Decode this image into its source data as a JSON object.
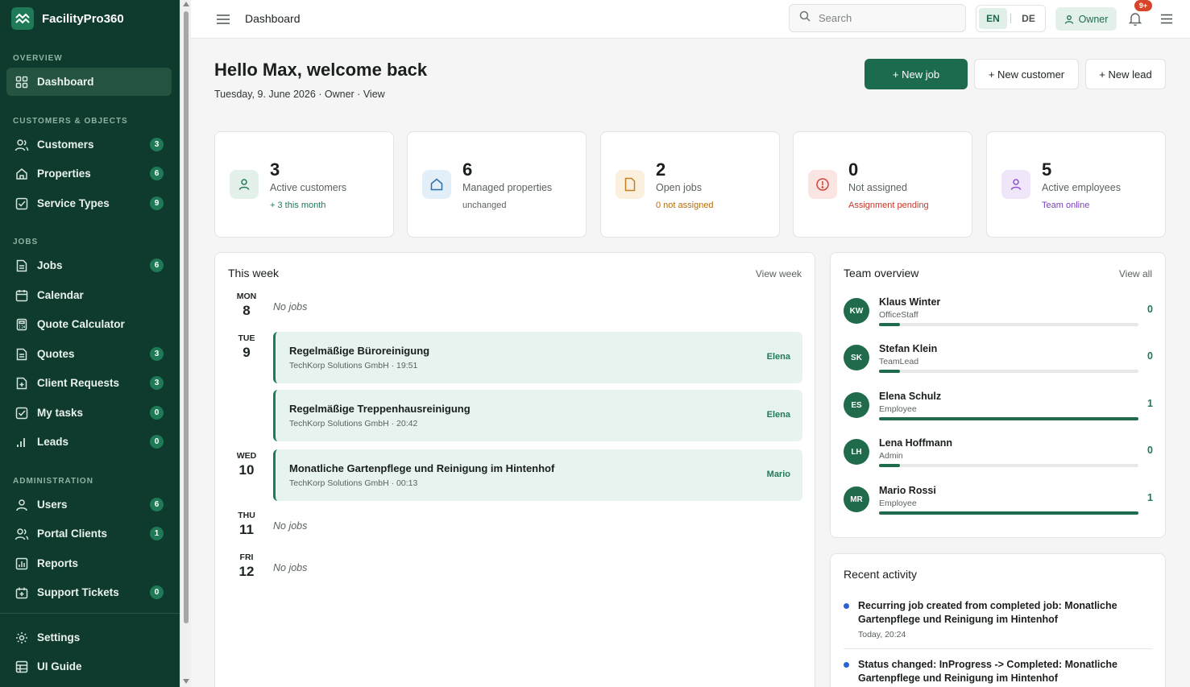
{
  "app": {
    "name": "FacilityPro360"
  },
  "sidebar": {
    "sections": [
      "OVERVIEW",
      "CUSTOMERS & OBJECTS",
      "JOBS",
      "ADMINISTRATION"
    ],
    "items": [
      {
        "label": "Dashboard",
        "icon": "grid-icon"
      },
      {
        "label": "Customers",
        "badge": "3",
        "icon": "users-icon"
      },
      {
        "label": "Properties",
        "badge": "6",
        "icon": "home-icon"
      },
      {
        "label": "Service Types",
        "badge": "9",
        "icon": "checkbox-icon"
      },
      {
        "label": "Jobs",
        "badge": "6",
        "icon": "document-icon"
      },
      {
        "label": "Calendar",
        "icon": "calendar-icon"
      },
      {
        "label": "Quote Calculator",
        "icon": "calculator-icon"
      },
      {
        "label": "Quotes",
        "badge": "3",
        "icon": "document-icon"
      },
      {
        "label": "Client Requests",
        "badge": "3",
        "icon": "file-plus-icon"
      },
      {
        "label": "My tasks",
        "badge": "0",
        "icon": "checkbox-icon"
      },
      {
        "label": "Leads",
        "badge": "0",
        "icon": "bar-chart-icon"
      },
      {
        "label": "Users",
        "badge": "6",
        "icon": "user-icon"
      },
      {
        "label": "Portal Clients",
        "badge": "1",
        "icon": "users-icon"
      },
      {
        "label": "Reports",
        "icon": "report-icon"
      },
      {
        "label": "Support Tickets",
        "badge": "0",
        "icon": "ticket-icon"
      },
      {
        "label": "Settings",
        "icon": "gear-icon"
      },
      {
        "label": "UI Guide",
        "icon": "table-icon"
      }
    ]
  },
  "topbar": {
    "breadcrumb": "Dashboard",
    "search_placeholder": "Search",
    "lang": [
      "EN",
      "DE"
    ],
    "role": "Owner",
    "notifications": "9+"
  },
  "header": {
    "greeting": "Hello Max, welcome back",
    "subline": "Tuesday, 9. June 2026 · Owner · View",
    "buttons": [
      "+ New job",
      "+ New customer",
      "+ New lead"
    ]
  },
  "stats": [
    {
      "value": "3",
      "label": "Active customers",
      "note": "+ 3 this month",
      "note_color": "#1f7a58",
      "icon": "user-icon",
      "icon_bg": "#e3f1ea",
      "icon_color": "#1f7a58"
    },
    {
      "value": "6",
      "label": "Managed properties",
      "note": "unchanged",
      "note_color": "#5a625e",
      "icon": "home-icon",
      "icon_bg": "#e3eff8",
      "icon_color": "#2e6fa8"
    },
    {
      "value": "2",
      "label": "Open jobs",
      "note": "0 not assigned",
      "note_color": "#b06d12",
      "icon": "document-icon",
      "icon_bg": "#fbf0de",
      "icon_color": "#c28021"
    },
    {
      "value": "0",
      "label": "Not assigned",
      "note": "Assignment pending",
      "note_color": "#c43a2b",
      "icon": "alert-circle-icon",
      "icon_bg": "#fbe5e3",
      "icon_color": "#d0423a"
    },
    {
      "value": "5",
      "label": "Active employees",
      "note": "Team online",
      "note_color": "#7a3fc4",
      "icon": "user-icon",
      "icon_bg": "#efe6fa",
      "icon_color": "#8a4fd4"
    }
  ],
  "week": {
    "title": "This week",
    "link": "View week",
    "no_jobs": "No jobs",
    "days": [
      {
        "name": "MON",
        "num": "8"
      },
      {
        "name": "TUE",
        "num": "9"
      },
      {
        "name": "WED",
        "num": "10"
      },
      {
        "name": "THU",
        "num": "11"
      },
      {
        "name": "FRI",
        "num": "12"
      }
    ],
    "jobs": [
      {
        "title": "Regelmäßige Büroreinigung",
        "sub": "TechKorp Solutions GmbH · 19:51",
        "who": "Elena"
      },
      {
        "title": "Regelmäßige Treppenhausreinigung",
        "sub": "TechKorp Solutions GmbH · 20:42",
        "who": "Elena"
      },
      {
        "title": "Monatliche Gartenpflege und Reinigung im Hintenhof",
        "sub": "TechKorp Solutions GmbH · 00:13",
        "who": "Mario"
      }
    ]
  },
  "team": {
    "title": "Team overview",
    "link": "View all",
    "members": [
      {
        "initials": "KW",
        "name": "Klaus Winter",
        "role": "OfficeStaff",
        "count": "0",
        "progress": 0.08
      },
      {
        "initials": "SK",
        "name": "Stefan Klein",
        "role": "TeamLead",
        "count": "0",
        "progress": 0.08
      },
      {
        "initials": "ES",
        "name": "Elena Schulz",
        "role": "Employee",
        "count": "1",
        "progress": 1.0
      },
      {
        "initials": "LH",
        "name": "Lena Hoffmann",
        "role": "Admin",
        "count": "0",
        "progress": 0.08
      },
      {
        "initials": "MR",
        "name": "Mario Rossi",
        "role": "Employee",
        "count": "1",
        "progress": 1.0
      }
    ]
  },
  "activity": {
    "title": "Recent activity",
    "items": [
      {
        "text": "Recurring job created from completed job: Monatliche Gartenpflege und Reinigung im Hintenhof",
        "time": "Today, 20:24"
      },
      {
        "text": "Status changed: InProgress -> Completed: Monatliche Gartenpflege und Reinigung im Hintenhof",
        "time": ""
      }
    ]
  }
}
